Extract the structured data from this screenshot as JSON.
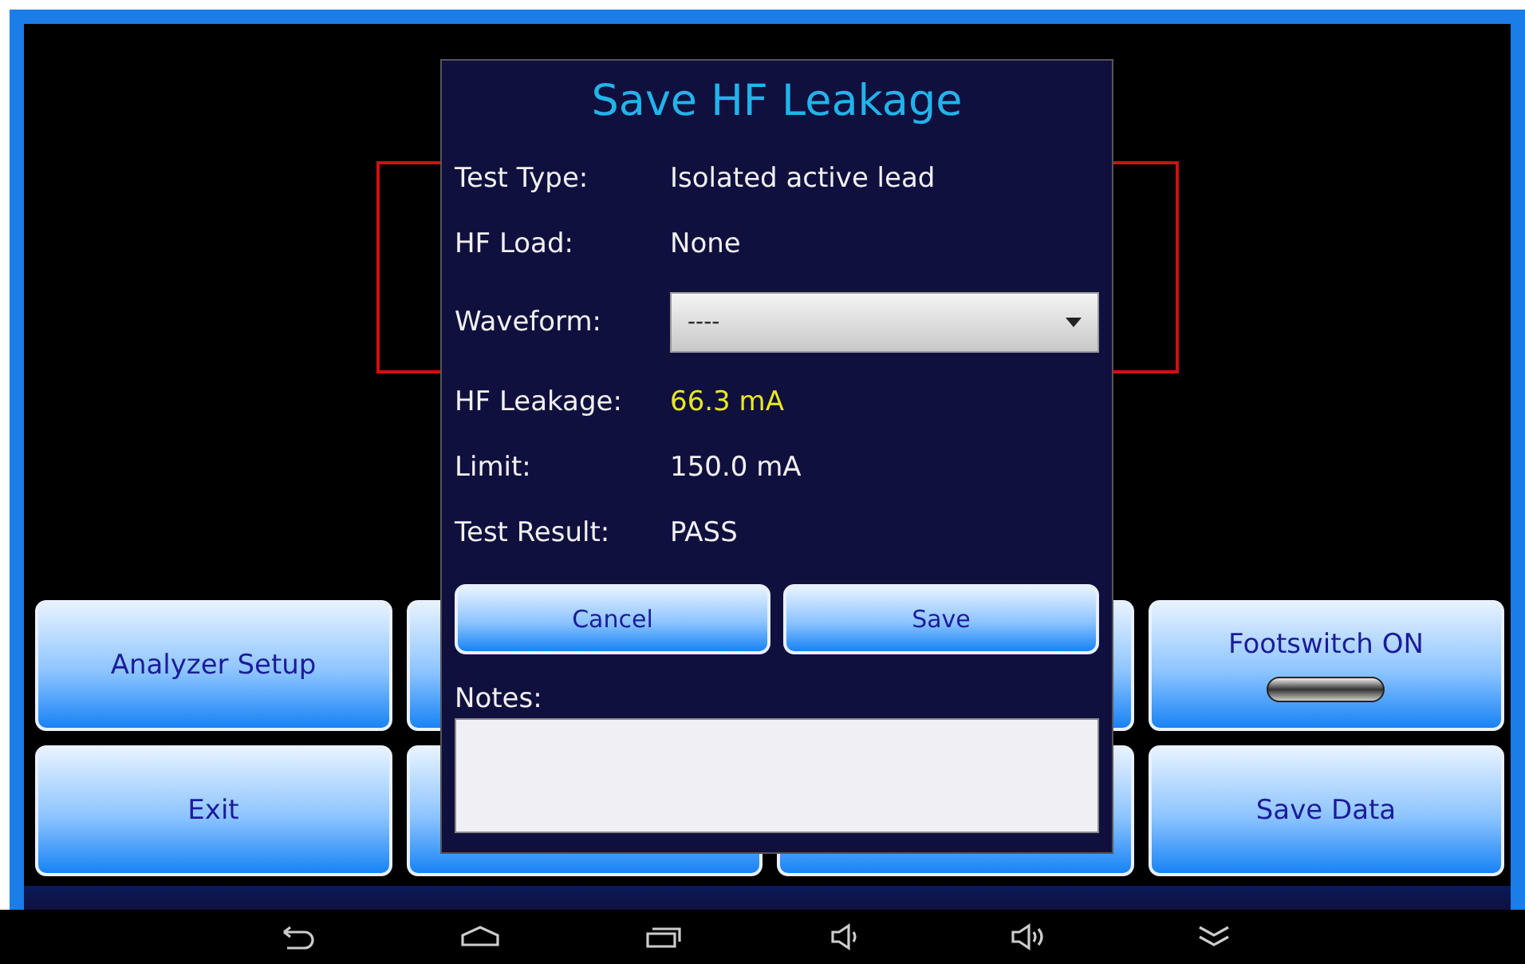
{
  "button_rows": [
    [
      {
        "label": "Analyzer Setup",
        "kind": "plain"
      },
      {
        "kind": "hidden"
      },
      {
        "kind": "hidden"
      },
      {
        "label": "Footswitch ON",
        "kind": "toggle"
      }
    ],
    [
      {
        "label": "Exit",
        "kind": "plain"
      },
      {
        "kind": "hidden"
      },
      {
        "kind": "hidden"
      },
      {
        "label": "Save Data",
        "kind": "plain"
      }
    ]
  ],
  "dialog": {
    "title": "Save HF Leakage",
    "fields": [
      {
        "label": "Test Type:",
        "value": "Isolated active lead",
        "kind": "text"
      },
      {
        "label": "HF Load:",
        "value": "None",
        "kind": "text"
      },
      {
        "label": "Waveform:",
        "value": "----",
        "kind": "dropdown"
      },
      {
        "label": "HF Leakage:",
        "value": "66.3 mA",
        "kind": "highlight"
      },
      {
        "label": "Limit:",
        "value": "150.0 mA",
        "kind": "text"
      },
      {
        "label": "Test Result:",
        "value": "PASS",
        "kind": "text"
      }
    ],
    "actions": [
      "Cancel",
      "Save"
    ],
    "notes_label": "Notes:"
  }
}
